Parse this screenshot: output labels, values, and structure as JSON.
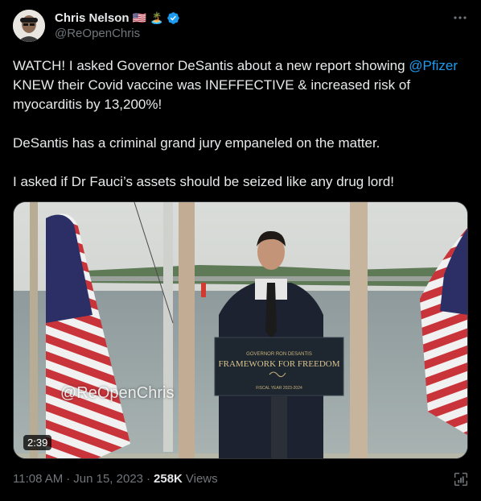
{
  "author": {
    "display_name": "Chris Nelson",
    "handle": "@ReOpenChris",
    "flag_emoji": "🇺🇸",
    "island_emoji": "🏝️",
    "verified_icon": "verified-badge-icon",
    "verified_color": "#1d9bf0"
  },
  "menu": {
    "more_icon": "more-horizontal-icon"
  },
  "body": {
    "para1_prefix": "WATCH! I asked Governor DeSantis about a new report showing ",
    "para1_mention": "@Pfizer",
    "para1_suffix": " KNEW their Covid vaccine was INEFFECTIVE & increased risk of myocarditis by 13,200%!",
    "para2": "DeSantis has a criminal grand jury empaneled on the matter.",
    "para3": "I asked if Dr Fauci’s assets should be seized like any drug lord!",
    "mention_color": "#1d9bf0"
  },
  "media": {
    "duration": "2:39",
    "watermark": "@ReOpenChris",
    "podium_line1": "GOVERNOR RON DESANTIS",
    "podium_line2": "FRAMEWORK FOR FREEDOM",
    "podium_line3": "FISCAL YEAR 2023-2024"
  },
  "footer": {
    "time": "11:08 AM",
    "date": "Jun 15, 2023",
    "views_count": "258K",
    "views_label": "Views",
    "separator": "·",
    "analytics_icon": "analytics-icon"
  }
}
